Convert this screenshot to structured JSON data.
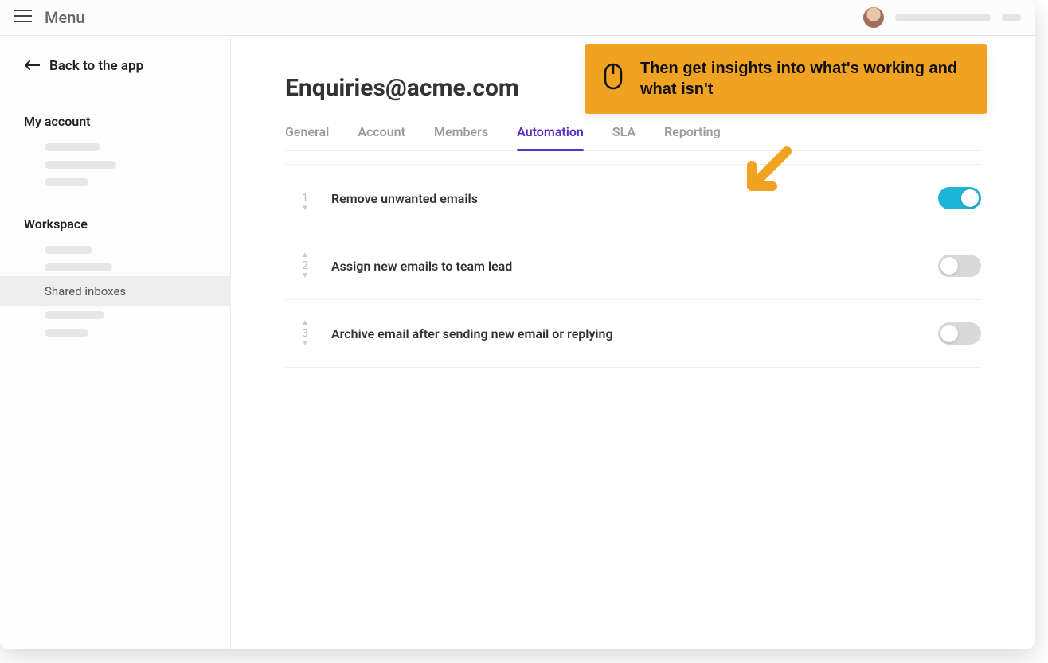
{
  "topbar": {
    "menu_label": "Menu"
  },
  "sidebar": {
    "back_label": "Back to the app",
    "sections": {
      "account_title": "My account",
      "workspace_title": "Workspace"
    },
    "shared_inboxes_label": "Shared inboxes"
  },
  "page": {
    "title": "Enquiries@acme.com"
  },
  "tabs": [
    {
      "label": "General",
      "active": false
    },
    {
      "label": "Account",
      "active": false
    },
    {
      "label": "Members",
      "active": false
    },
    {
      "label": "Automation",
      "active": true
    },
    {
      "label": "SLA",
      "active": false
    },
    {
      "label": "Reporting",
      "active": false
    }
  ],
  "rules": [
    {
      "index": "1",
      "label": "Remove unwanted emails",
      "enabled": true,
      "can_up": false,
      "can_down": true
    },
    {
      "index": "2",
      "label": "Assign new emails to team lead",
      "enabled": false,
      "can_up": true,
      "can_down": true
    },
    {
      "index": "3",
      "label": "Archive email after sending new email or replying",
      "enabled": false,
      "can_up": true,
      "can_down": true
    }
  ],
  "callout": {
    "text": "Then get insights into what's working and what isn't"
  },
  "colors": {
    "accent_purple": "#5a2fc2",
    "callout_orange": "#f0a323",
    "toggle_on": "#1cb5d8"
  }
}
